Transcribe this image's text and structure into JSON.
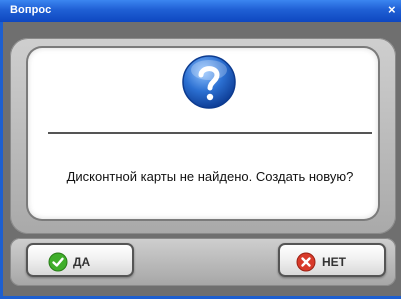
{
  "window": {
    "title": "Вопрос",
    "close_glyph": "×"
  },
  "dialog": {
    "icon": "question-icon",
    "message": "Дисконтной карты не найдено. Создать новую?"
  },
  "buttons": {
    "yes_label": "ДА",
    "yes_icon": "check-icon",
    "no_label": "НЕТ",
    "no_icon": "cross-icon"
  },
  "colors": {
    "titlebar": "#1f5fd4",
    "yes_icon": "#3fae2a",
    "no_icon": "#d83a2a",
    "question_icon": "#2b6fd1"
  }
}
